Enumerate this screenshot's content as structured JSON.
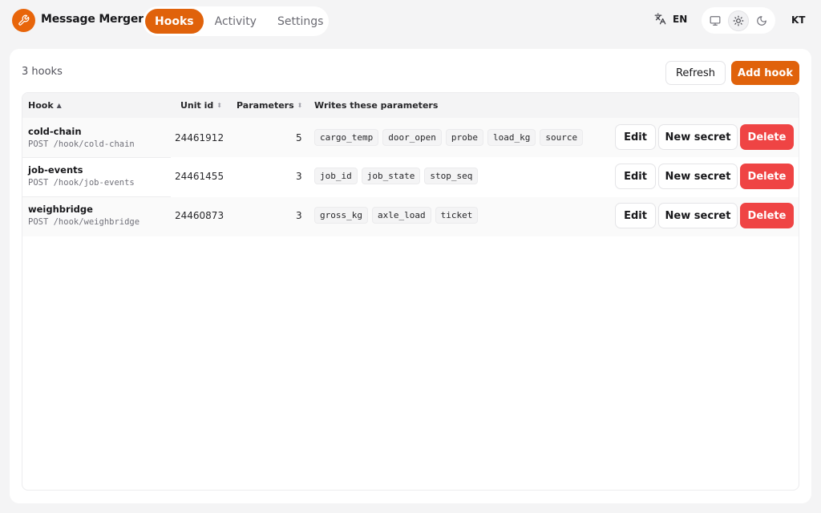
{
  "app": {
    "name": "Message Merger",
    "logo_icon": "wrench-icon",
    "accent": "#e0620b"
  },
  "nav": {
    "tabs": [
      {
        "label": "Hooks",
        "active": true
      },
      {
        "label": "Activity",
        "active": false
      },
      {
        "label": "Settings",
        "active": false
      }
    ]
  },
  "language": {
    "icon": "translate-icon",
    "label": "EN"
  },
  "theme": {
    "options": [
      "monitor-icon",
      "sun-icon",
      "moon-icon"
    ],
    "selected": "sun-icon"
  },
  "user": {
    "initials": "KT"
  },
  "hooks_panel": {
    "count_label": "3 hooks",
    "refresh_label": "Refresh",
    "add_label": "Add hook",
    "columns": {
      "hook": "Hook",
      "unit_id": "Unit id",
      "parameters": "Parameters",
      "writes": "Writes these parameters"
    },
    "sorted_column": "Hook",
    "rows": [
      {
        "name": "cold-chain",
        "route": "POST /hook/cold-chain",
        "unit_id": "24461912",
        "param_count": "5",
        "params": [
          "cargo_temp",
          "door_open",
          "probe",
          "load_kg",
          "source"
        ],
        "edit_label": "Edit",
        "secret_label": "New secret",
        "delete_label": "Delete"
      },
      {
        "name": "job-events",
        "route": "POST /hook/job-events",
        "unit_id": "24461455",
        "param_count": "3",
        "params": [
          "job_id",
          "job_state",
          "stop_seq"
        ],
        "edit_label": "Edit",
        "secret_label": "New secret",
        "delete_label": "Delete"
      },
      {
        "name": "weighbridge",
        "route": "POST /hook/weighbridge",
        "unit_id": "24460873",
        "param_count": "3",
        "params": [
          "gross_kg",
          "axle_load",
          "ticket"
        ],
        "edit_label": "Edit",
        "secret_label": "New secret",
        "delete_label": "Delete"
      }
    ]
  }
}
